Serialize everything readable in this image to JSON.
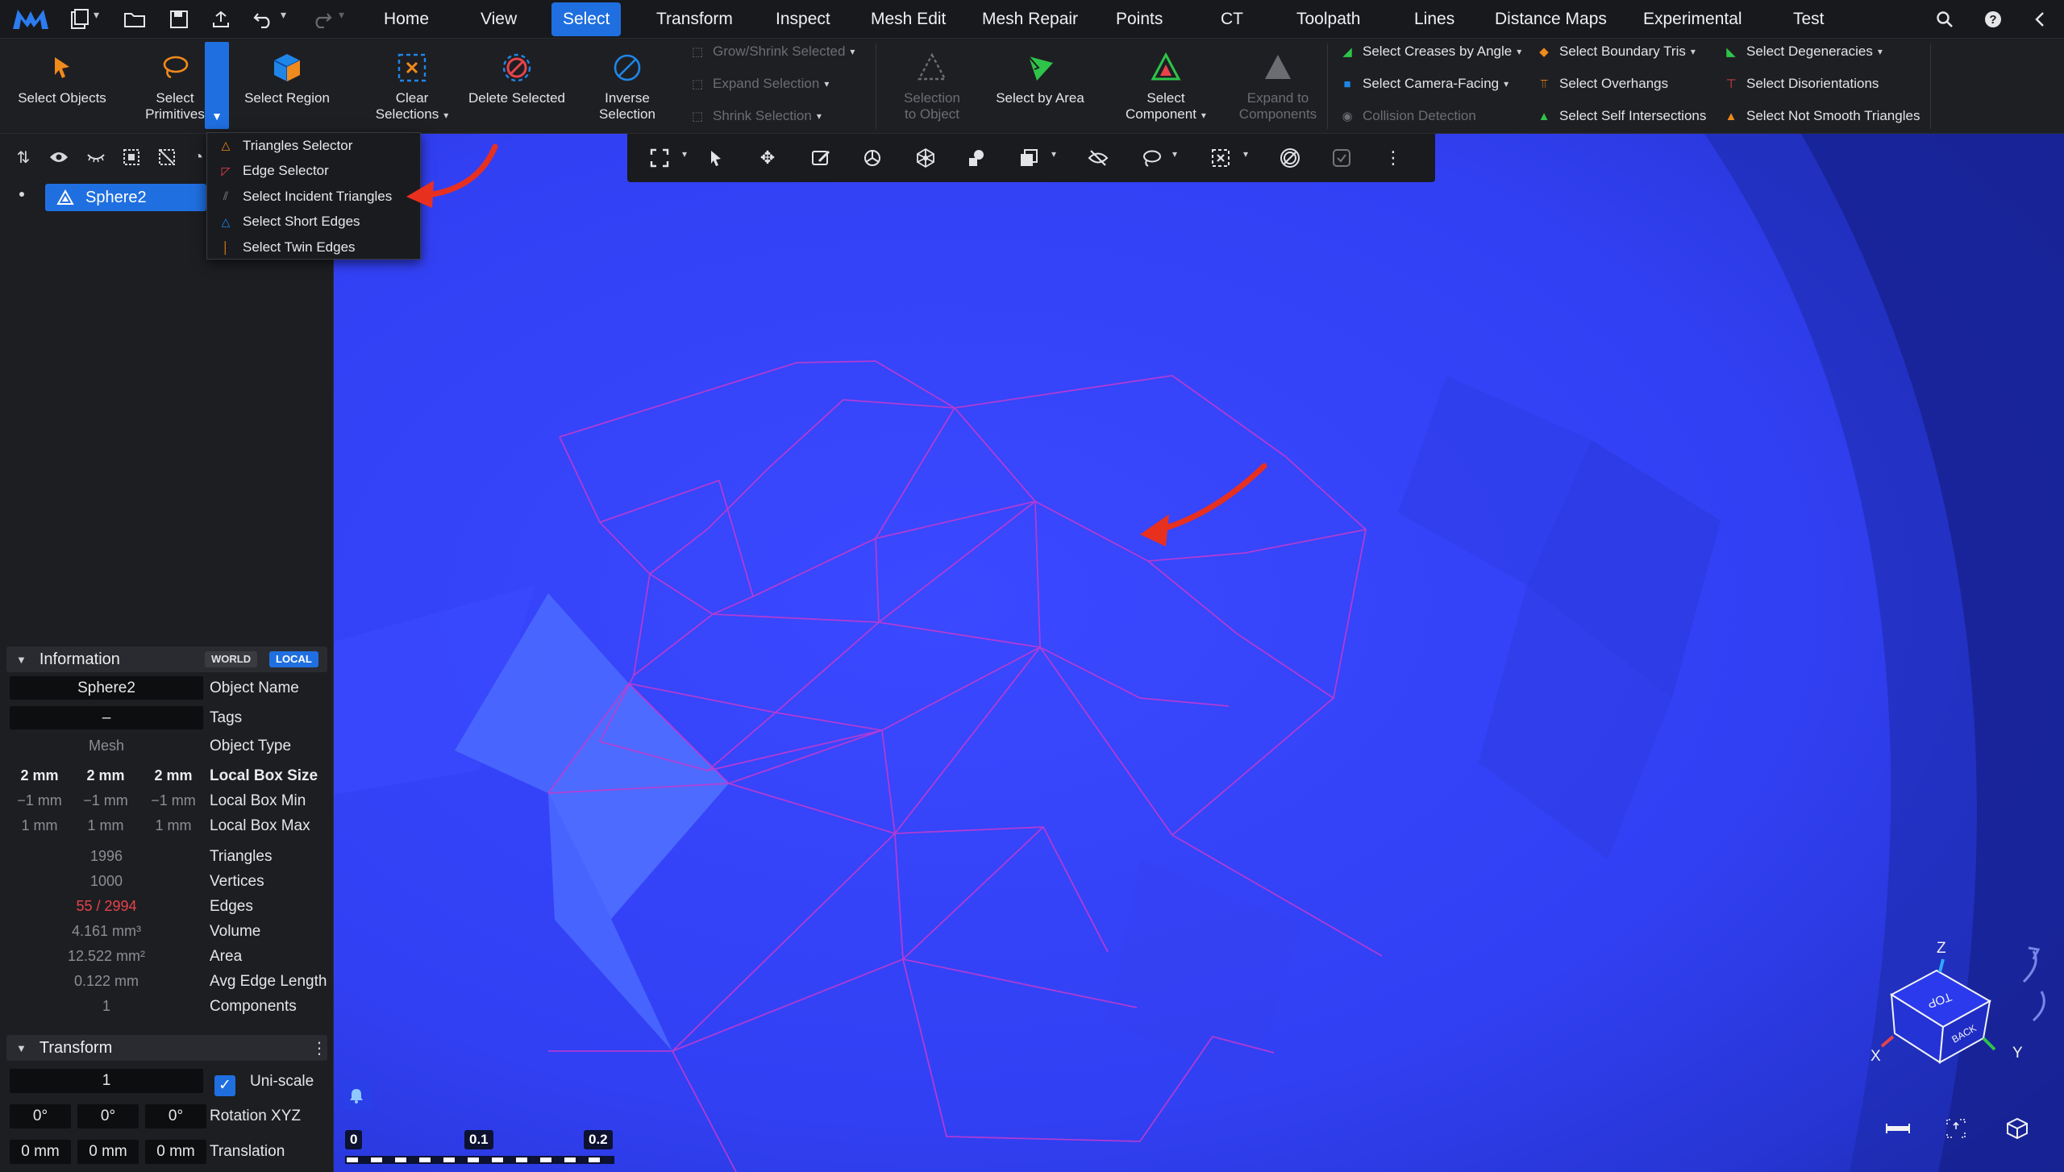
{
  "menubar": {
    "items": [
      "Home",
      "View",
      "Select",
      "Transform",
      "Inspect",
      "Mesh Edit",
      "Mesh Repair",
      "Points",
      "CT",
      "Toolpath",
      "Lines",
      "Distance Maps",
      "Experimental",
      "Test"
    ],
    "active": "Select"
  },
  "ribbon": {
    "select_objects": "Select Objects",
    "select_primitives": "Select\nPrimitives",
    "select_region": "Select Region",
    "clear_selections": "Clear\nSelections",
    "delete_selected": "Delete Selected",
    "inverse_selection": "Inverse\nSelection",
    "grow_shrink": "Grow/Shrink Selected",
    "expand_selection": "Expand Selection",
    "shrink_selection": "Shrink Selection",
    "selection_to_object": "Selection\nto Object",
    "select_by_area": "Select by Area",
    "select_component": "Select\nComponent",
    "expand_to_components": "Expand to\nComponents",
    "select_creases": "Select Creases by Angle",
    "select_camera_facing": "Select Camera-Facing",
    "collision_detection": "Collision Detection",
    "select_boundary_tris": "Select Boundary Tris",
    "select_overhangs": "Select Overhangs",
    "select_self_intersections": "Select Self Intersections",
    "select_degeneracies": "Select Degeneracies",
    "select_disorientations": "Select Disorientations",
    "select_not_smooth": "Select Not Smooth Triangles"
  },
  "dropdown": {
    "items": [
      "Triangles Selector",
      "Edge Selector",
      "Select Incident Triangles",
      "Select Short Edges",
      "Select Twin Edges"
    ]
  },
  "tree": {
    "object": "Sphere2"
  },
  "information": {
    "title": "Information",
    "world": "WORLD",
    "local": "LOCAL",
    "object_name_value": "Sphere2",
    "object_name_key": "Object Name",
    "tags_value": "–",
    "tags_key": "Tags",
    "object_type_value": "Mesh",
    "object_type_key": "Object Type",
    "box_size": [
      "2 mm",
      "2 mm",
      "2 mm"
    ],
    "box_size_key": "Local Box Size",
    "box_min": [
      "−1 mm",
      "−1 mm",
      "−1 mm"
    ],
    "box_min_key": "Local Box Min",
    "box_max": [
      "1 mm",
      "1 mm",
      "1 mm"
    ],
    "box_max_key": "Local Box Max",
    "triangles_value": "1996",
    "triangles_key": "Triangles",
    "vertices_value": "1000",
    "vertices_key": "Vertices",
    "edges_value": "55 / 2994",
    "edges_key": "Edges",
    "volume_value": "4.161 mm³",
    "volume_key": "Volume",
    "area_value": "12.522 mm²",
    "area_key": "Area",
    "avg_edge_value": "0.122 mm",
    "avg_edge_key": "Avg Edge Length",
    "components_value": "1",
    "components_key": "Components"
  },
  "transform": {
    "title": "Transform",
    "uniscale_value": "1",
    "uniscale_label": "Uni-scale",
    "rotation": [
      "0°",
      "0°",
      "0°"
    ],
    "rotation_label": "Rotation XYZ",
    "translation": [
      "0 mm",
      "0 mm",
      "0 mm"
    ],
    "translation_label": "Translation"
  },
  "scale_bar": {
    "labels": [
      "0",
      "0.1",
      "0.2"
    ]
  },
  "view_cube": {
    "top": "TOP",
    "back": "BACK",
    "axis_x": "X",
    "axis_y": "Y",
    "axis_z": "Z"
  },
  "colors": {
    "accent": "#1f6fe0",
    "viewport_blue": "#2f3cf6",
    "selection_edge": "#c53ad0",
    "annotation_arrow": "#e8301f"
  }
}
